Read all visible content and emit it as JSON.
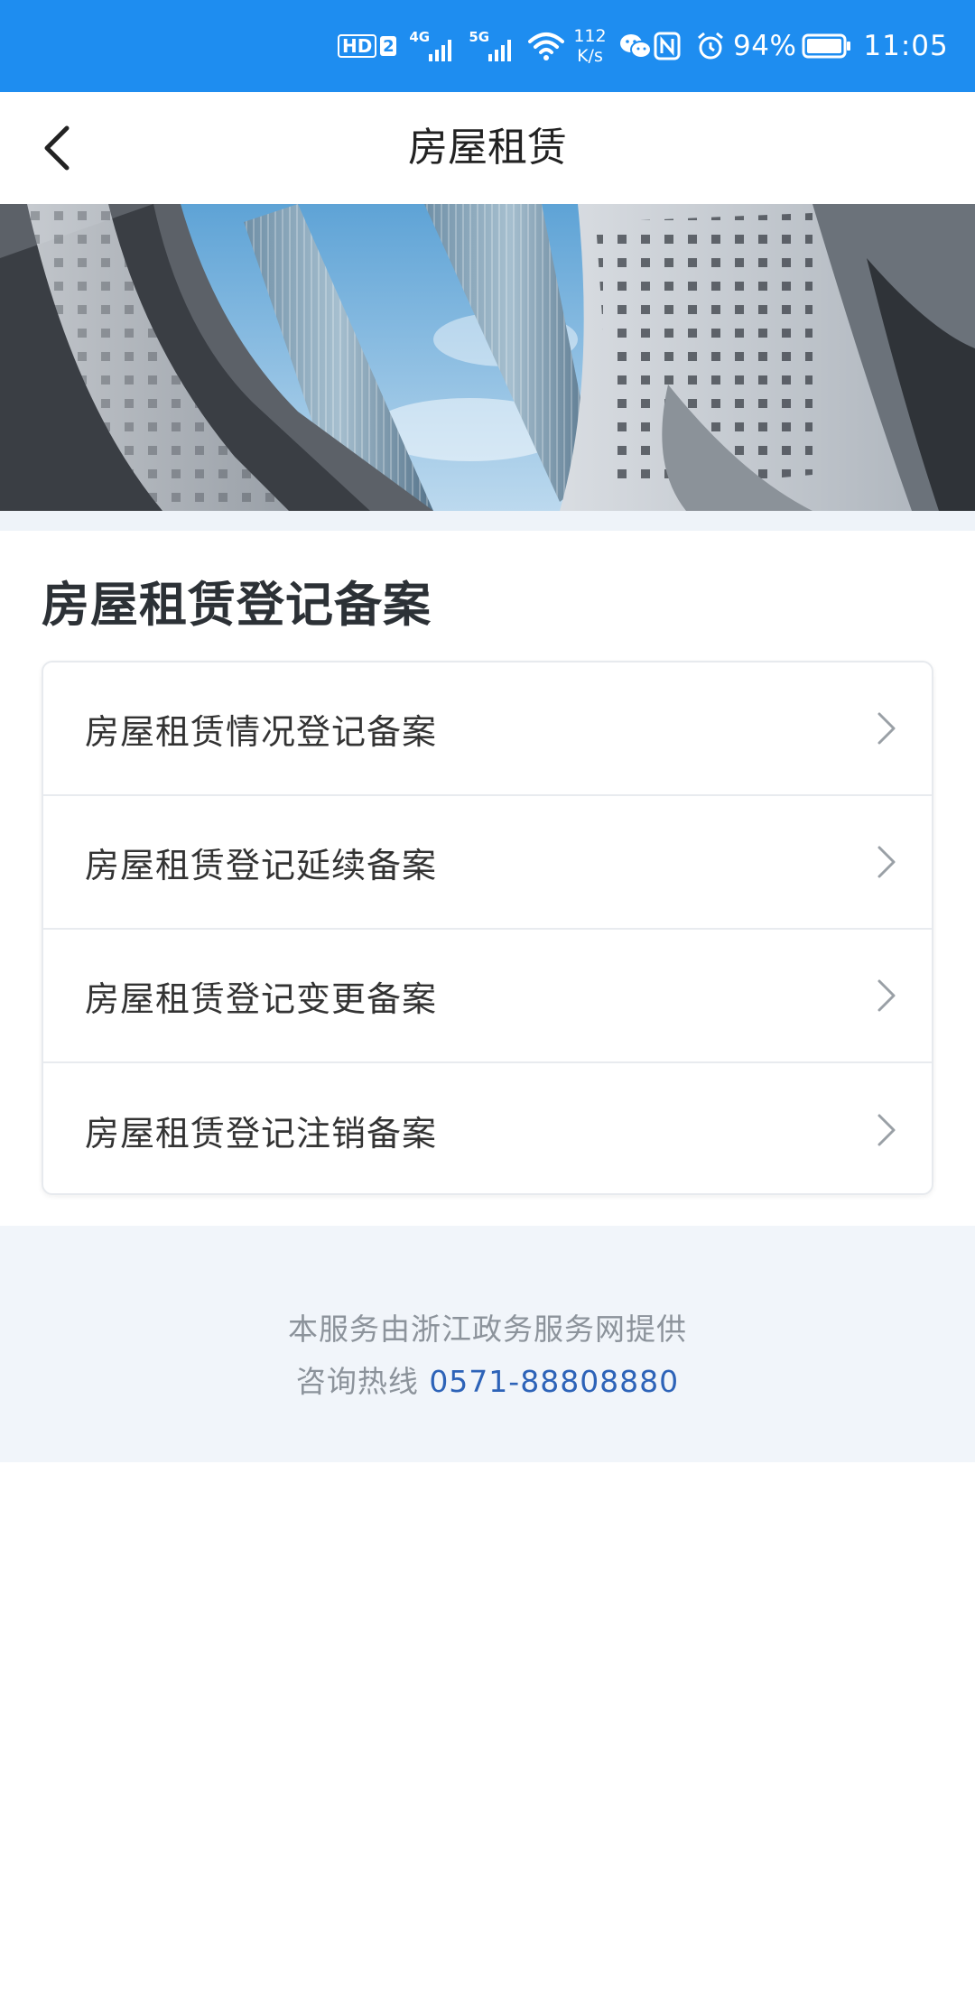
{
  "status_bar": {
    "hd_label": "HD",
    "sim_label": "2",
    "net1_label": "4G",
    "net2_label": "5G",
    "speed_value": "112",
    "speed_unit": "K/s",
    "battery_percent": "94%",
    "time": "11:05",
    "background_color": "#1e8df0"
  },
  "nav": {
    "title": "房屋租赁",
    "back_icon": "chevron-left-icon"
  },
  "section": {
    "title": "房屋租赁登记备案"
  },
  "menu_items": [
    {
      "label": "房屋租赁情况登记备案",
      "icon": "chevron-right-icon"
    },
    {
      "label": "房屋租赁登记延续备案",
      "icon": "chevron-right-icon"
    },
    {
      "label": "房屋租赁登记变更备案",
      "icon": "chevron-right-icon"
    },
    {
      "label": "房屋租赁登记注销备案",
      "icon": "chevron-right-icon"
    }
  ],
  "footer": {
    "provider_text": "本服务由浙江政务服务网提供",
    "hotline_label": "咨询热线",
    "hotline_number": "0571-88808880"
  },
  "colors": {
    "accent": "#1e8df0",
    "link": "#2d63b8",
    "footer_bg": "#f1f5fa"
  }
}
